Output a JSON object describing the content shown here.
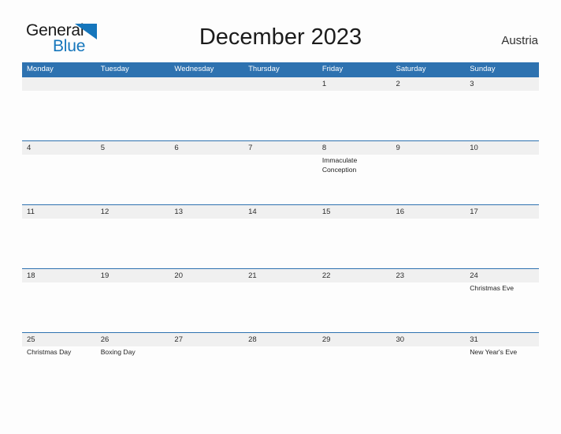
{
  "brand": {
    "name_part1": "General",
    "name_part2": "Blue",
    "accent_color": "#1576bc",
    "triangle_icon": "triangle-flag-icon"
  },
  "header": {
    "title": "December 2023",
    "country": "Austria"
  },
  "calendar": {
    "header_bg": "#2e72b0",
    "number_strip_bg": "#f0f0f0",
    "weekday_headers": [
      "Monday",
      "Tuesday",
      "Wednesday",
      "Thursday",
      "Friday",
      "Saturday",
      "Sunday"
    ],
    "weeks": [
      {
        "days": [
          {
            "num": "",
            "event": ""
          },
          {
            "num": "",
            "event": ""
          },
          {
            "num": "",
            "event": ""
          },
          {
            "num": "",
            "event": ""
          },
          {
            "num": "1",
            "event": ""
          },
          {
            "num": "2",
            "event": ""
          },
          {
            "num": "3",
            "event": ""
          }
        ]
      },
      {
        "days": [
          {
            "num": "4",
            "event": ""
          },
          {
            "num": "5",
            "event": ""
          },
          {
            "num": "6",
            "event": ""
          },
          {
            "num": "7",
            "event": ""
          },
          {
            "num": "8",
            "event": "Immaculate Conception"
          },
          {
            "num": "9",
            "event": ""
          },
          {
            "num": "10",
            "event": ""
          }
        ]
      },
      {
        "days": [
          {
            "num": "11",
            "event": ""
          },
          {
            "num": "12",
            "event": ""
          },
          {
            "num": "13",
            "event": ""
          },
          {
            "num": "14",
            "event": ""
          },
          {
            "num": "15",
            "event": ""
          },
          {
            "num": "16",
            "event": ""
          },
          {
            "num": "17",
            "event": ""
          }
        ]
      },
      {
        "days": [
          {
            "num": "18",
            "event": ""
          },
          {
            "num": "19",
            "event": ""
          },
          {
            "num": "20",
            "event": ""
          },
          {
            "num": "21",
            "event": ""
          },
          {
            "num": "22",
            "event": ""
          },
          {
            "num": "23",
            "event": ""
          },
          {
            "num": "24",
            "event": "Christmas Eve"
          }
        ]
      },
      {
        "days": [
          {
            "num": "25",
            "event": "Christmas Day"
          },
          {
            "num": "26",
            "event": "Boxing Day"
          },
          {
            "num": "27",
            "event": ""
          },
          {
            "num": "28",
            "event": ""
          },
          {
            "num": "29",
            "event": ""
          },
          {
            "num": "30",
            "event": ""
          },
          {
            "num": "31",
            "event": "New Year's Eve"
          }
        ]
      }
    ]
  }
}
